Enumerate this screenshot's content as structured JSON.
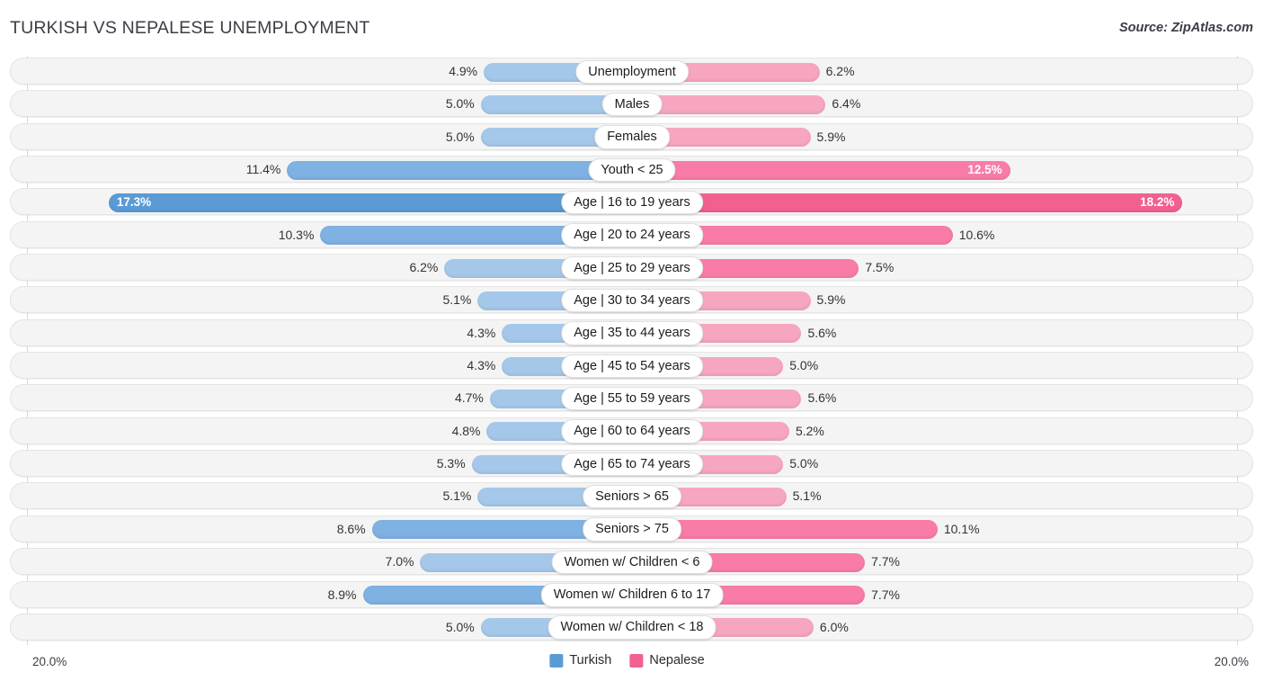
{
  "header": {
    "title": "TURKISH VS NEPALESE UNEMPLOYMENT",
    "source": "Source: ZipAtlas.com"
  },
  "axis": {
    "left_label": "20.0%",
    "right_label": "20.0%",
    "max": 20.0
  },
  "legend": {
    "items": [
      {
        "label": "Turkish",
        "color": "#5b9bd5"
      },
      {
        "label": "Nepalese",
        "color": "#f2608f"
      }
    ]
  },
  "colors": {
    "blue_light": "#a5c8ea",
    "blue_mid": "#7fb1e3",
    "blue_dark": "#5b9bd5",
    "pink_light": "#f7a6c0",
    "pink_mid": "#f97ba8",
    "pink_dark": "#f2608f",
    "track": "#f4f4f4",
    "gridline": "#d8d8d8"
  },
  "chart_data": {
    "type": "bar",
    "title": "TURKISH VS NEPALESE UNEMPLOYMENT",
    "subtitle": "Source: ZipAtlas.com",
    "orientation": "horizontal-diverging",
    "xlabel": "",
    "ylabel": "",
    "xlim": [
      20.0,
      20.0
    ],
    "grid": true,
    "legend_position": "bottom-center",
    "categories": [
      "Unemployment",
      "Males",
      "Females",
      "Youth < 25",
      "Age | 16 to 19 years",
      "Age | 20 to 24 years",
      "Age | 25 to 29 years",
      "Age | 30 to 34 years",
      "Age | 35 to 44 years",
      "Age | 45 to 54 years",
      "Age | 55 to 59 years",
      "Age | 60 to 64 years",
      "Age | 65 to 74 years",
      "Seniors > 65",
      "Seniors > 75",
      "Women w/ Children < 6",
      "Women w/ Children 6 to 17",
      "Women w/ Children < 18"
    ],
    "series": [
      {
        "name": "Turkish",
        "values": [
          4.9,
          5.0,
          5.0,
          11.4,
          17.3,
          10.3,
          6.2,
          5.1,
          4.3,
          4.3,
          4.7,
          4.8,
          5.3,
          5.1,
          8.6,
          7.0,
          8.9,
          5.0
        ]
      },
      {
        "name": "Nepalese",
        "values": [
          6.2,
          6.4,
          5.9,
          12.5,
          18.2,
          10.6,
          7.5,
          5.9,
          5.6,
          5.0,
          5.6,
          5.2,
          5.0,
          5.1,
          10.1,
          7.7,
          7.7,
          6.0
        ]
      }
    ]
  },
  "rows": [
    {
      "label": "Unemployment",
      "left_value": "4.9%",
      "right_value": "6.2%",
      "left": 4.9,
      "right": 6.2,
      "left_tone": "blue_light",
      "right_tone": "pink_light",
      "left_inside": false,
      "right_inside": false
    },
    {
      "label": "Males",
      "left_value": "5.0%",
      "right_value": "6.4%",
      "left": 5.0,
      "right": 6.4,
      "left_tone": "blue_light",
      "right_tone": "pink_light",
      "left_inside": false,
      "right_inside": false
    },
    {
      "label": "Females",
      "left_value": "5.0%",
      "right_value": "5.9%",
      "left": 5.0,
      "right": 5.9,
      "left_tone": "blue_light",
      "right_tone": "pink_light",
      "left_inside": false,
      "right_inside": false
    },
    {
      "label": "Youth < 25",
      "left_value": "11.4%",
      "right_value": "12.5%",
      "left": 11.4,
      "right": 12.5,
      "left_tone": "blue_mid",
      "right_tone": "pink_mid",
      "left_inside": false,
      "right_inside": true
    },
    {
      "label": "Age | 16 to 19 years",
      "left_value": "17.3%",
      "right_value": "18.2%",
      "left": 17.3,
      "right": 18.2,
      "left_tone": "blue_dark",
      "right_tone": "pink_dark",
      "left_inside": true,
      "right_inside": true
    },
    {
      "label": "Age | 20 to 24 years",
      "left_value": "10.3%",
      "right_value": "10.6%",
      "left": 10.3,
      "right": 10.6,
      "left_tone": "blue_mid",
      "right_tone": "pink_mid",
      "left_inside": false,
      "right_inside": false
    },
    {
      "label": "Age | 25 to 29 years",
      "left_value": "6.2%",
      "right_value": "7.5%",
      "left": 6.2,
      "right": 7.5,
      "left_tone": "blue_light",
      "right_tone": "pink_mid",
      "left_inside": false,
      "right_inside": false
    },
    {
      "label": "Age | 30 to 34 years",
      "left_value": "5.1%",
      "right_value": "5.9%",
      "left": 5.1,
      "right": 5.9,
      "left_tone": "blue_light",
      "right_tone": "pink_light",
      "left_inside": false,
      "right_inside": false
    },
    {
      "label": "Age | 35 to 44 years",
      "left_value": "4.3%",
      "right_value": "5.6%",
      "left": 4.3,
      "right": 5.6,
      "left_tone": "blue_light",
      "right_tone": "pink_light",
      "left_inside": false,
      "right_inside": false
    },
    {
      "label": "Age | 45 to 54 years",
      "left_value": "4.3%",
      "right_value": "5.0%",
      "left": 4.3,
      "right": 5.0,
      "left_tone": "blue_light",
      "right_tone": "pink_light",
      "left_inside": false,
      "right_inside": false
    },
    {
      "label": "Age | 55 to 59 years",
      "left_value": "4.7%",
      "right_value": "5.6%",
      "left": 4.7,
      "right": 5.6,
      "left_tone": "blue_light",
      "right_tone": "pink_light",
      "left_inside": false,
      "right_inside": false
    },
    {
      "label": "Age | 60 to 64 years",
      "left_value": "4.8%",
      "right_value": "5.2%",
      "left": 4.8,
      "right": 5.2,
      "left_tone": "blue_light",
      "right_tone": "pink_light",
      "left_inside": false,
      "right_inside": false
    },
    {
      "label": "Age | 65 to 74 years",
      "left_value": "5.3%",
      "right_value": "5.0%",
      "left": 5.3,
      "right": 5.0,
      "left_tone": "blue_light",
      "right_tone": "pink_light",
      "left_inside": false,
      "right_inside": false
    },
    {
      "label": "Seniors > 65",
      "left_value": "5.1%",
      "right_value": "5.1%",
      "left": 5.1,
      "right": 5.1,
      "left_tone": "blue_light",
      "right_tone": "pink_light",
      "left_inside": false,
      "right_inside": false
    },
    {
      "label": "Seniors > 75",
      "left_value": "8.6%",
      "right_value": "10.1%",
      "left": 8.6,
      "right": 10.1,
      "left_tone": "blue_mid",
      "right_tone": "pink_mid",
      "left_inside": false,
      "right_inside": false
    },
    {
      "label": "Women w/ Children < 6",
      "left_value": "7.0%",
      "right_value": "7.7%",
      "left": 7.0,
      "right": 7.7,
      "left_tone": "blue_light",
      "right_tone": "pink_mid",
      "left_inside": false,
      "right_inside": false
    },
    {
      "label": "Women w/ Children 6 to 17",
      "left_value": "8.9%",
      "right_value": "7.7%",
      "left": 8.9,
      "right": 7.7,
      "left_tone": "blue_mid",
      "right_tone": "pink_mid",
      "left_inside": false,
      "right_inside": false
    },
    {
      "label": "Women w/ Children < 18",
      "left_value": "5.0%",
      "right_value": "6.0%",
      "left": 5.0,
      "right": 6.0,
      "left_tone": "blue_light",
      "right_tone": "pink_light",
      "left_inside": false,
      "right_inside": false
    }
  ]
}
